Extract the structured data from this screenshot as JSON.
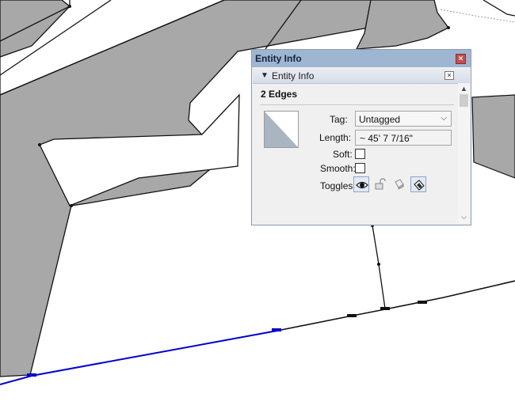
{
  "panel": {
    "title": "Entity Info",
    "close_label": "×",
    "section": {
      "label": "Entity Info",
      "collapse_glyph": "▼",
      "close_label": "×"
    },
    "heading": "2 Edges",
    "tag": {
      "label": "Tag:",
      "value": "Untagged",
      "arrow": "⌵"
    },
    "length": {
      "label": "Length:",
      "value": "~ 45' 7 7/16\""
    },
    "soft": {
      "label": "Soft:",
      "checked": false
    },
    "smooth": {
      "label": "Smooth:",
      "checked": false
    },
    "toggles": {
      "label": "Toggles:",
      "items": [
        {
          "icon": "eye-icon",
          "active": true
        },
        {
          "icon": "padlock-icon",
          "active": false
        },
        {
          "icon": "shadow-cast-icon",
          "active": false
        },
        {
          "icon": "shadow-receive-icon",
          "active": true
        }
      ]
    },
    "scroll": {
      "up": "▲",
      "down": "⌵"
    }
  },
  "colors": {
    "faces": "#a8a8a8",
    "selected_edge": "#0000d0",
    "titlebar": "#9fb6d3",
    "material_swatch": "#a9b6c2"
  }
}
